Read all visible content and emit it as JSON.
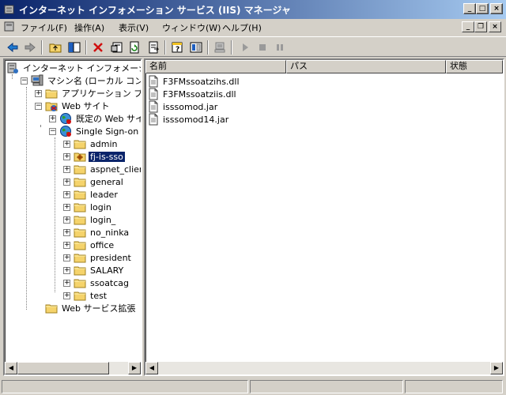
{
  "window": {
    "title": "インターネット インフォメーション サービス (IIS) マネージャ",
    "caption_buttons": [
      "_",
      "□",
      "×"
    ],
    "mdi_buttons": [
      "_",
      "❐",
      "×"
    ]
  },
  "menu": [
    {
      "label": "ファイル(F)"
    },
    {
      "label": "操作(A)"
    },
    {
      "label": "表示(V)"
    },
    {
      "label": "ウィンドウ(W)"
    },
    {
      "label": "ヘルプ(H)"
    }
  ],
  "toolbar": [
    "back-icon",
    "forward-icon",
    "up-folder-icon",
    "show-hide-tree-icon",
    "delete-icon",
    "properties-icon",
    "refresh-icon",
    "export-list-icon",
    "help-icon",
    "console-icon",
    "computer-icon",
    "start-icon",
    "stop-icon",
    "pause-icon"
  ],
  "tree": [
    {
      "label": "インターネット インフォメーション",
      "level": 0,
      "icon": "iis-icon",
      "expander": ""
    },
    {
      "label": "マシン名 (ローカル コンピュータ)",
      "level": 1,
      "icon": "computer-icon",
      "expander": "−"
    },
    {
      "label": "アプリケーション プール",
      "level": 2,
      "icon": "folder-icon",
      "expander": "+"
    },
    {
      "label": "Web サイト",
      "level": 2,
      "icon": "web-sites-icon",
      "expander": "−"
    },
    {
      "label": "既定の Web サイト",
      "level": 3,
      "icon": "globe-icon",
      "expander": "+"
    },
    {
      "label": "Single Sign-on (停止)",
      "level": 3,
      "icon": "globe-icon",
      "expander": "−"
    },
    {
      "label": "admin",
      "level": 4,
      "icon": "folder-icon",
      "expander": "+"
    },
    {
      "label": "fj-is-sso",
      "level": 4,
      "icon": "virtual-dir-icon",
      "expander": "+",
      "selected": true
    },
    {
      "label": "aspnet_client",
      "level": 4,
      "icon": "folder-icon",
      "expander": "+"
    },
    {
      "label": "general",
      "level": 4,
      "icon": "folder-icon",
      "expander": "+"
    },
    {
      "label": "leader",
      "level": 4,
      "icon": "folder-icon",
      "expander": "+"
    },
    {
      "label": "login",
      "level": 4,
      "icon": "folder-icon",
      "expander": "+"
    },
    {
      "label": "login_",
      "level": 4,
      "icon": "folder-icon",
      "expander": "+"
    },
    {
      "label": "no_ninka",
      "level": 4,
      "icon": "folder-icon",
      "expander": "+"
    },
    {
      "label": "office",
      "level": 4,
      "icon": "folder-icon",
      "expander": "+"
    },
    {
      "label": "president",
      "level": 4,
      "icon": "folder-icon",
      "expander": "+"
    },
    {
      "label": "SALARY",
      "level": 4,
      "icon": "folder-icon",
      "expander": "+"
    },
    {
      "label": "ssoatcag",
      "level": 4,
      "icon": "folder-icon",
      "expander": "+"
    },
    {
      "label": "test",
      "level": 4,
      "icon": "folder-icon",
      "expander": "+"
    },
    {
      "label": "Web サービス拡張",
      "level": 2,
      "icon": "folder-icon",
      "expander": ""
    }
  ],
  "list": {
    "columns": [
      "名前",
      "パス",
      "状態"
    ],
    "files": [
      {
        "name": "F3FMssoatzihs.dll",
        "icon": "file-icon"
      },
      {
        "name": "F3FMssoatziis.dll",
        "icon": "file-icon"
      },
      {
        "name": "isssomod.jar",
        "icon": "file-icon"
      },
      {
        "name": "isssomod14.jar",
        "icon": "file-icon"
      }
    ]
  },
  "colors": {
    "title_start": "#0a246a",
    "title_end": "#a6caf0",
    "selection": "#0a246a",
    "face": "#d4d0c8"
  }
}
